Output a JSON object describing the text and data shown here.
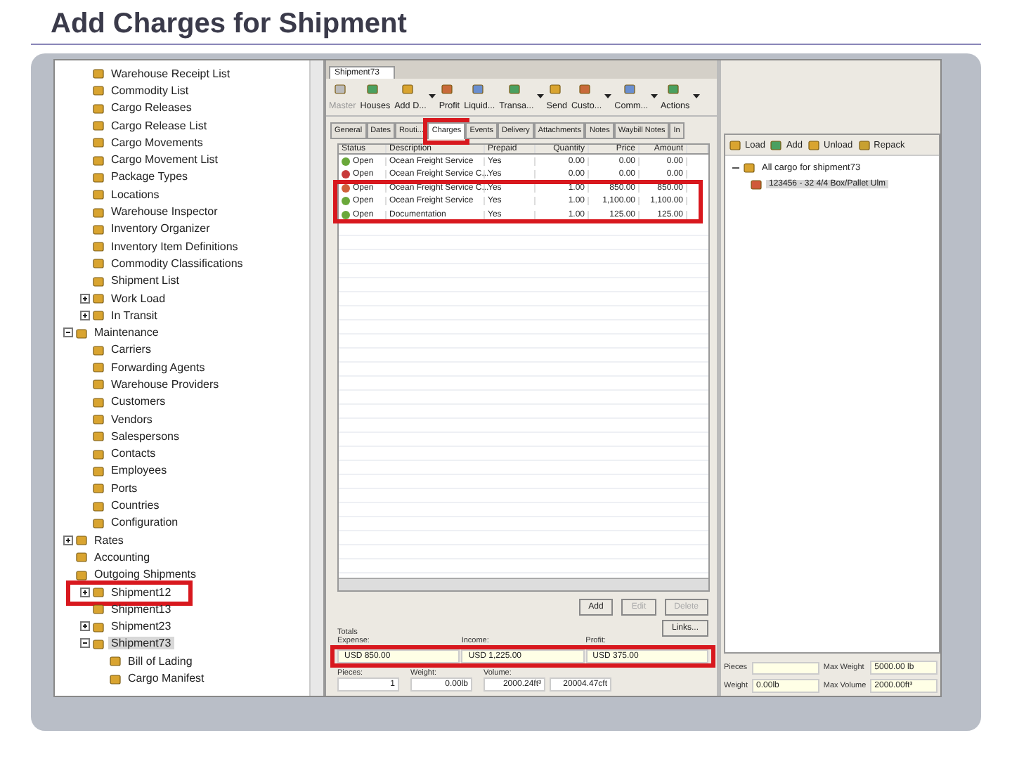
{
  "slide_title": "Add Charges for  Shipment",
  "tree": {
    "scrolled_children": [
      {
        "label": "Warehouse Receipt List",
        "selected": false,
        "highlighted": false
      },
      {
        "label": "Commodity List",
        "selected": false,
        "highlighted": false
      },
      {
        "label": "Cargo Releases",
        "selected": false,
        "highlighted": false
      },
      {
        "label": "Cargo Release List",
        "selected": false,
        "highlighted": false
      },
      {
        "label": "Cargo Movements",
        "selected": false,
        "highlighted": false
      },
      {
        "label": "Cargo Movement List",
        "selected": false,
        "highlighted": false
      },
      {
        "label": "Package Types",
        "selected": false,
        "highlighted": false
      },
      {
        "label": "Locations",
        "selected": false,
        "highlighted": false
      },
      {
        "label": "Warehouse Inspector",
        "selected": false,
        "highlighted": false
      },
      {
        "label": "Inventory Organizer",
        "selected": false,
        "highlighted": false
      },
      {
        "label": "Inventory Item Definitions",
        "selected": false,
        "highlighted": false
      },
      {
        "label": "Commodity Classifications",
        "selected": false,
        "highlighted": false
      },
      {
        "label": "Shipment List",
        "selected": false,
        "highlighted": false
      },
      {
        "label": "Work Load",
        "expanded": false,
        "selected": false,
        "highlighted": false
      },
      {
        "label": "In Transit",
        "expanded": false,
        "selected": false,
        "highlighted": false
      }
    ],
    "items": [
      {
        "label": "Maintenance",
        "expanded": true,
        "selected": false,
        "highlighted": false,
        "children": [
          {
            "label": "Carriers",
            "selected": false,
            "highlighted": false
          },
          {
            "label": "Forwarding Agents",
            "selected": false,
            "highlighted": false
          },
          {
            "label": "Warehouse Providers",
            "selected": false,
            "highlighted": false
          },
          {
            "label": "Customers",
            "selected": false,
            "highlighted": false
          },
          {
            "label": "Vendors",
            "selected": false,
            "highlighted": false
          },
          {
            "label": "Salespersons",
            "selected": false,
            "highlighted": false
          },
          {
            "label": "Contacts",
            "selected": false,
            "highlighted": false
          },
          {
            "label": "Employees",
            "selected": false,
            "highlighted": false
          },
          {
            "label": "Ports",
            "selected": false,
            "highlighted": false
          },
          {
            "label": "Countries",
            "selected": false,
            "highlighted": false
          },
          {
            "label": "Configuration",
            "selected": false,
            "highlighted": false
          }
        ]
      },
      {
        "label": "Rates",
        "expanded": false,
        "selected": false,
        "highlighted": false
      },
      {
        "label": "Accounting",
        "selected": false,
        "highlighted": false
      },
      {
        "label": "Outgoing Shipments",
        "selected": false,
        "highlighted": false,
        "children": [
          {
            "label": "Shipment12",
            "expanded": false,
            "selected": false,
            "highlighted": true
          },
          {
            "label": "Shipment13",
            "selected": false,
            "highlighted": false
          },
          {
            "label": "Shipment23",
            "expanded": false,
            "selected": false,
            "highlighted": false
          },
          {
            "label": "Shipment73",
            "expanded": true,
            "selected": true,
            "highlighted": false,
            "children": [
              {
                "label": "Bill of Lading",
                "selected": false,
                "highlighted": false
              },
              {
                "label": "Cargo Manifest",
                "selected": false,
                "highlighted": false
              }
            ]
          }
        ]
      }
    ]
  },
  "document_tab": "Shipment73",
  "toolbar": [
    {
      "label": "Master",
      "dropdown": false,
      "disabled": true
    },
    {
      "label": "Houses",
      "dropdown": false,
      "disabled": false
    },
    {
      "label": "Add D...",
      "dropdown": true,
      "disabled": false
    },
    {
      "label": "Profit",
      "dropdown": false,
      "disabled": false
    },
    {
      "label": "Liquid...",
      "dropdown": false,
      "disabled": false
    },
    {
      "label": "Transa...",
      "dropdown": true,
      "disabled": false
    },
    {
      "label": "Send",
      "dropdown": false,
      "disabled": false
    },
    {
      "label": "Custo...",
      "dropdown": true,
      "disabled": false
    },
    {
      "label": "Comm...",
      "dropdown": true,
      "disabled": false
    },
    {
      "label": "Actions",
      "dropdown": true,
      "disabled": false
    }
  ],
  "tabs": [
    {
      "label": "General",
      "selected": false,
      "highlighted": false
    },
    {
      "label": "Dates",
      "selected": false,
      "highlighted": false
    },
    {
      "label": "Routi...",
      "selected": false,
      "highlighted": false
    },
    {
      "label": "Charges",
      "selected": true,
      "highlighted": true
    },
    {
      "label": "Events",
      "selected": false,
      "highlighted": false
    },
    {
      "label": "Delivery",
      "selected": false,
      "highlighted": false
    },
    {
      "label": "Attachments",
      "selected": false,
      "highlighted": false
    },
    {
      "label": "Notes",
      "selected": false,
      "highlighted": false
    },
    {
      "label": "Waybill Notes",
      "selected": false,
      "highlighted": false
    },
    {
      "label": "In",
      "selected": false,
      "highlighted": false
    }
  ],
  "table": {
    "columns": [
      "Status",
      "Description",
      "Prepaid",
      "Quantity",
      "Price",
      "Amount"
    ],
    "rows": [
      {
        "color": "#6aa83a",
        "highlighted": false,
        "cells": [
          "Open",
          "Ocean Freight Service",
          "Yes",
          "0.00",
          "0.00",
          "0.00"
        ]
      },
      {
        "color": "#c83a3a",
        "highlighted": false,
        "cells": [
          "Open",
          "Ocean Freight Service C...",
          "Yes",
          "0.00",
          "0.00",
          "0.00"
        ]
      },
      {
        "color": "#d0603a",
        "highlighted": true,
        "cells": [
          "Open",
          "Ocean Freight Service C...",
          "Yes",
          "1.00",
          "850.00",
          "850.00"
        ]
      },
      {
        "color": "#6aa83a",
        "highlighted": true,
        "cells": [
          "Open",
          "Ocean Freight Service",
          "Yes",
          "1.00",
          "1,100.00",
          "1,100.00"
        ]
      },
      {
        "color": "#6aa83a",
        "highlighted": true,
        "cells": [
          "Open",
          "Documentation",
          "Yes",
          "1.00",
          "125.00",
          "125.00"
        ]
      }
    ]
  },
  "buttons": [
    {
      "label": "Add",
      "disabled": false
    },
    {
      "label": "Edit",
      "disabled": true
    },
    {
      "label": "Delete",
      "disabled": true
    }
  ],
  "totals": {
    "title": "Totals",
    "highlighted": true,
    "fields": [
      {
        "label": "Expense:",
        "value": "USD 850.00"
      },
      {
        "label": "Income:",
        "value": "USD 1,225.00"
      },
      {
        "label": "Profit:",
        "value": "USD 375.00"
      }
    ],
    "links_button": "Links..."
  },
  "measures": [
    {
      "label": "Pieces:",
      "values": [
        "1"
      ]
    },
    {
      "label": "Weight:",
      "values": [
        "0.00lb"
      ]
    },
    {
      "label": "Volume:",
      "values": [
        "2000.24ft³",
        "20004.47cft"
      ]
    }
  ],
  "cargo": {
    "toolbar": [
      "Load",
      "Add",
      "Unload",
      "Repack"
    ],
    "tree": {
      "label": "All cargo for shipment73",
      "expanded": true,
      "children": [
        {
          "label": "123456 - 32 4/4 Box/Pallet Ulm",
          "selected": true
        }
      ]
    },
    "fields": [
      {
        "label": "Pieces"
      },
      {
        "label": "Max Weight",
        "value": "5000.00 lb"
      },
      {
        "label": "Weight",
        "value": "0.00lb"
      },
      {
        "label": "Max Volume",
        "value": "2000.00ft³"
      }
    ]
  }
}
